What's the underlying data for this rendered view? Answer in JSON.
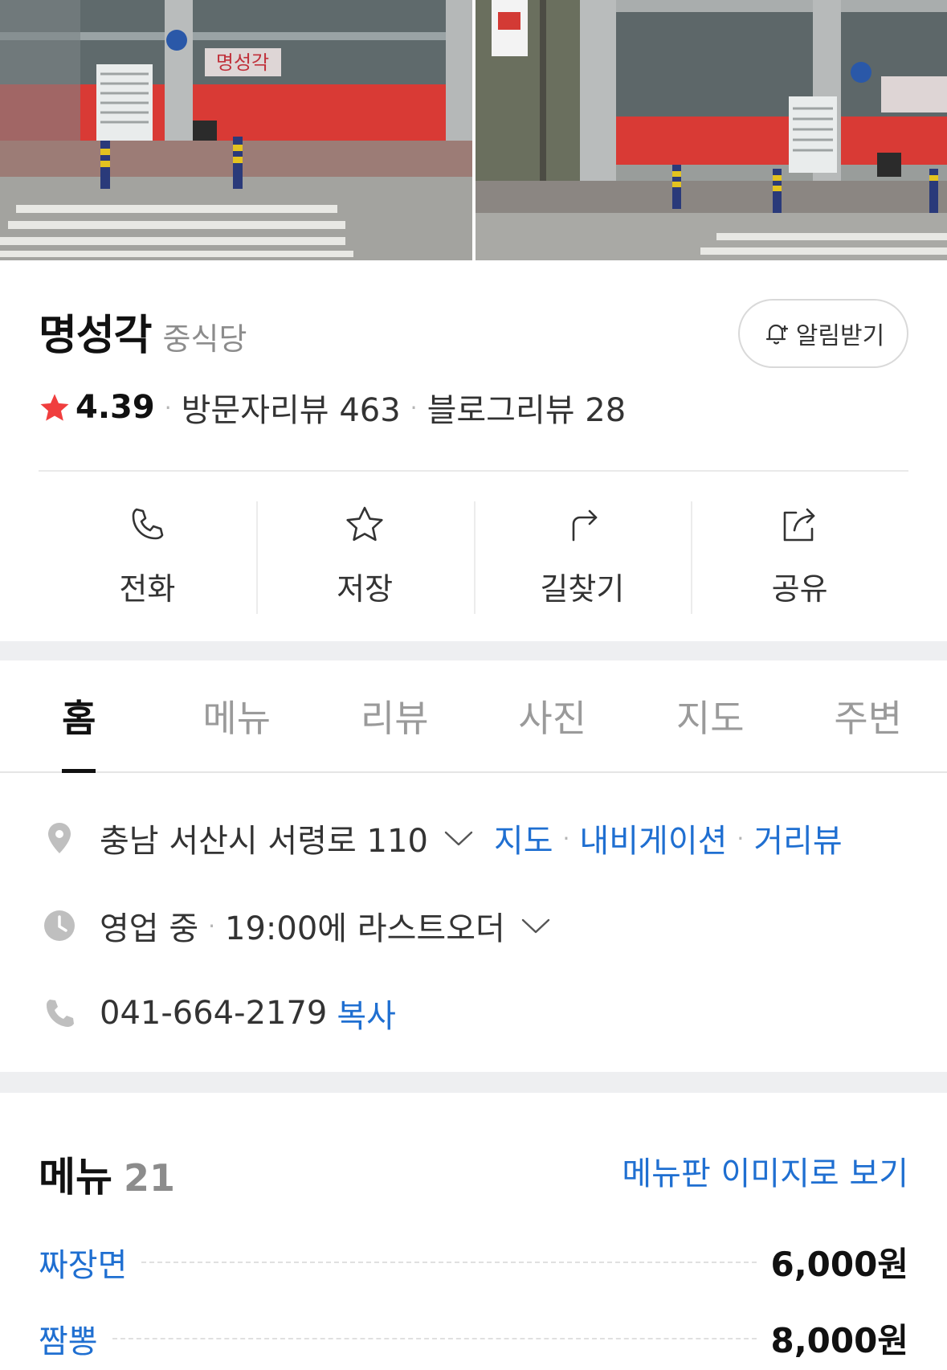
{
  "place": {
    "name": "명성각",
    "category": "중식당",
    "alarm_label": "알림받기",
    "rating_score": "4.39",
    "visitor_reviews": "방문자리뷰 463",
    "blog_reviews": "블로그리뷰 28",
    "dot": "·"
  },
  "actions": [
    {
      "label": "전화",
      "icon": "phone-icon"
    },
    {
      "label": "저장",
      "icon": "star-outline-icon"
    },
    {
      "label": "길찾기",
      "icon": "directions-icon"
    },
    {
      "label": "공유",
      "icon": "share-icon"
    }
  ],
  "tabs": [
    {
      "label": "홈",
      "active": true
    },
    {
      "label": "메뉴"
    },
    {
      "label": "리뷰"
    },
    {
      "label": "사진"
    },
    {
      "label": "지도"
    },
    {
      "label": "주변"
    }
  ],
  "info": {
    "address": "충남 서산시 서령로 110",
    "address_links": [
      "지도",
      "내비게이션",
      "거리뷰"
    ],
    "hours_status": "영업 중",
    "hours_detail": "19:00에 라스트오더",
    "phone": "041-664-2179",
    "copy_label": "복사"
  },
  "menu": {
    "title": "메뉴",
    "count": "21",
    "view_image_label": "메뉴판 이미지로 보기",
    "items": [
      {
        "name": "짜장면",
        "price": "6,000원"
      },
      {
        "name": "짬뽕",
        "price": "8,000원"
      }
    ]
  },
  "photos": {
    "sign_text": "명성각"
  },
  "colors": {
    "accent_blue": "#1f6fd1",
    "star_red": "#f03e3e",
    "divider_gray": "#eeeff1"
  }
}
